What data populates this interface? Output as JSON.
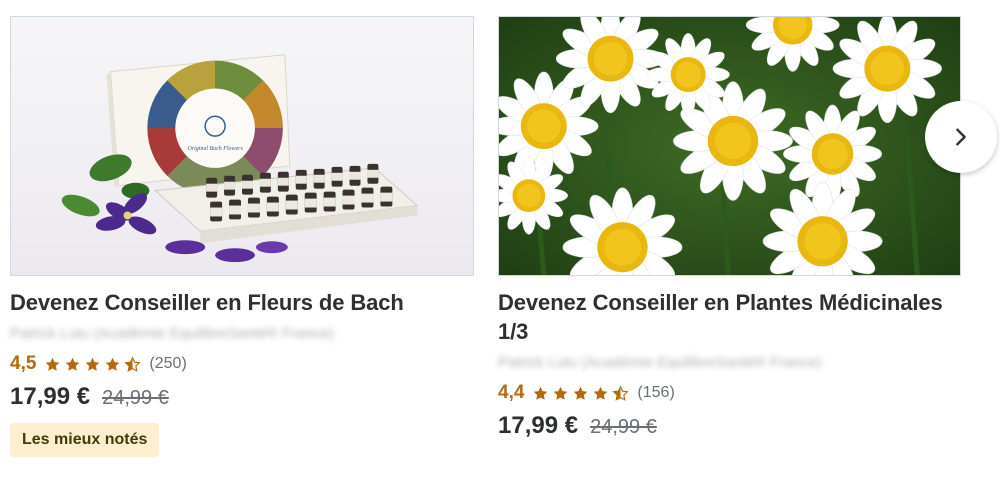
{
  "courses": [
    {
      "title": "Devenez Conseiller en Fleurs de Bach",
      "instructor": "Patrick Lutu (Académie EquilibreSanté® France)",
      "rating": "4,5",
      "rating_value": 4.5,
      "reviews": "(250)",
      "price": "17,99 €",
      "old_price": "24,99 €",
      "badge": "Les mieux notés",
      "image_icon": "bach-flower-remedies-box",
      "box_label": "Original Bach Flowers"
    },
    {
      "title": "Devenez Conseiller en Plantes Médicinales 1/3",
      "instructor": "Patrick Lutu (Académie EquilibreSanté® France)",
      "rating": "4,4",
      "rating_value": 4.4,
      "reviews": "(156)",
      "price": "17,99 €",
      "old_price": "24,99 €",
      "image_icon": "chamomile-flowers"
    }
  ],
  "carousel": {
    "next_icon": "chevron-right-icon"
  },
  "colors": {
    "rating": "#b4690e",
    "badge_bg": "#fdeed0",
    "text": "#2d2f31",
    "muted": "#6a6f73"
  }
}
